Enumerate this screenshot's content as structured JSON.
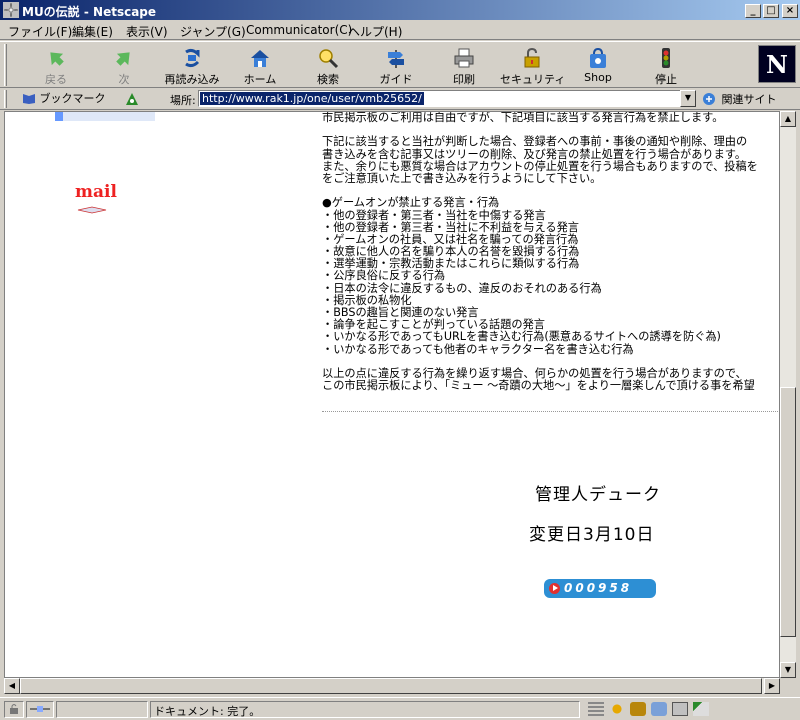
{
  "window": {
    "title": "MUの伝説 - Netscape",
    "minimize": "_",
    "maximize": "□",
    "close": "×"
  },
  "menu": [
    "ファイル(F)",
    "編集(E)",
    "表示(V)",
    "ジャンプ(G)",
    "Communicator(C)",
    "ヘルプ(H)"
  ],
  "toolbar": {
    "back": "戻る",
    "forward": "次",
    "reload": "再読み込み",
    "home": "ホーム",
    "search": "検索",
    "guide": "ガイド",
    "print": "印刷",
    "security": "セキュリティ",
    "shop": "Shop",
    "stop": "停止",
    "logo": "N"
  },
  "location": {
    "bookmark": "ブックマーク",
    "label": "場所:",
    "url": "http://www.rak1.jp/one/user/vmb25652/",
    "related": "関連サイト"
  },
  "page": {
    "mail": "mail",
    "rules_lines": [
      "市民掲示板のご利用は自由ですが、下記項目に該当する発言行為を禁止します。",
      "",
      "下記に該当すると当社が判断した場合、登録者への事前・事後の通知や削除、理由の",
      "書き込みを含む記事又はツリーの削除、及び発言の禁止処置を行う場合があります。",
      "また、余りにも悪質な場合はアカウントの停止処置を行う場合もありますので、投稿を",
      "をご注意頂いた上で書き込みを行うようにして下さい。",
      "",
      "●ゲームオンが禁止する発言・行為",
      "・他の登録者・第三者・当社を中傷する発言",
      "・他の登録者・第三者・当社に不利益を与える発言",
      "・ゲームオンの社員、又は社名を騙っての発言行為",
      "・故意に他人の名を騙り本人の名誉を毀損する行為",
      "・選挙運動・宗教活動またはこれらに類似する行為",
      "・公序良俗に反する行為",
      "・日本の法令に違反するもの、違反のおそれのある行為",
      "・掲示板の私物化",
      "・BBSの趣旨と関連のない発言",
      "・論争を起こすことが判っている話題の発言",
      "・いかなる形であってもURLを書き込む行為(悪意あるサイトへの誘導を防ぐ為)",
      "・いかなる形であっても他者のキャラクター名を書き込む行為",
      "",
      "以上の点に違反する行為を繰り返す場合、何らかの処置を行う場合がありますので、",
      "この市民掲示板により、「ミュー ～奇蹟の大地～」をより一層楽しんで頂ける事を希望"
    ],
    "admin": "管理人デューク",
    "changed": "変更日3月10日",
    "counter": "000958"
  },
  "status": {
    "text": "ドキュメント: 完了。"
  }
}
